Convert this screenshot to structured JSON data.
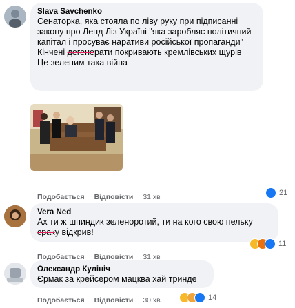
{
  "comments": [
    {
      "author": "Slava Savchenko",
      "lines": [
        "Сенаторка, яка стояла по ліву руку при підписанні",
        "закону про Ленд Ліз Україні \"яка заробляє політичний",
        "капітал і просуває наративи російської пропаганди\"",
        "Кінчені ",
        "рати покривають кремлівських щурів",
        "Це зеленим така війна"
      ],
      "strike_word": "дегене",
      "actions": [
        "Подобається",
        "Відповісти",
        "31 хв"
      ],
      "reaction_count": "21"
    },
    {
      "author": "Vera Ned",
      "lines": [
        "Ах ти ж шпиндик зеленоротий, ти на кого свою пельку",
        "у відкрив!"
      ],
      "strike_word": "срак",
      "actions": [
        "Подобається",
        "Відповісти",
        "31 хв"
      ],
      "reaction_count": "11"
    },
    {
      "author": "Олександр Кулініч",
      "lines": [
        "Єрмак за крейсером мацква хай тринде"
      ],
      "actions": [
        "Подобається",
        "Відповісти",
        "30 хв"
      ],
      "reaction_count": "14"
    }
  ],
  "colors": {
    "bubble": "#f0f2f5",
    "meta": "#65676b",
    "strike": "#e0245e"
  }
}
